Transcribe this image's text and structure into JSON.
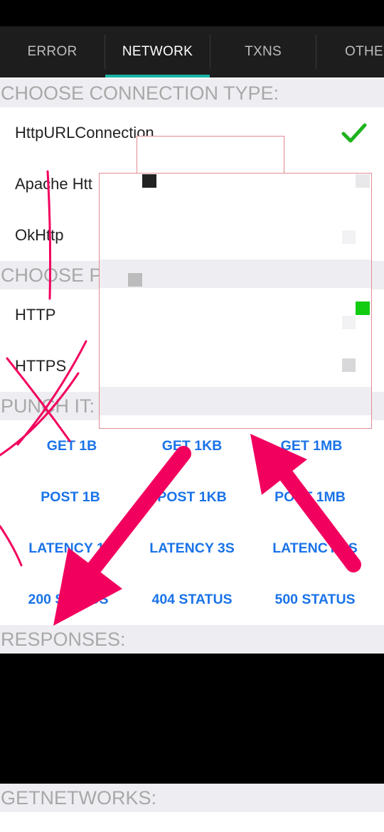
{
  "tabs": [
    {
      "label": "ERROR",
      "active": false
    },
    {
      "label": "NETWORK",
      "active": true
    },
    {
      "label": "TXNS",
      "active": false
    },
    {
      "label": "OTHE",
      "active": false
    }
  ],
  "sections": {
    "connection_type": "CHOOSE CONNECTION TYPE:",
    "protocol": "CHOOSE P",
    "punch_it": "PUNCH IT:",
    "responses": "RESPONSES:",
    "getnetworks": "GETNETWORKS:"
  },
  "connection_options": [
    {
      "label": "HttpURLConnection",
      "selected": true
    },
    {
      "label": "Apache Htt",
      "selected": false
    },
    {
      "label": "OkHttp",
      "selected": false
    }
  ],
  "protocol_options": [
    {
      "label": "HTTP"
    },
    {
      "label": "HTTPS"
    }
  ],
  "actions": [
    [
      "GET 1B",
      "GET 1KB",
      "GET 1MB"
    ],
    [
      "POST 1B",
      "POST 1KB",
      "POST 1MB"
    ],
    [
      "LATENCY 1S",
      "LATENCY 3S",
      "LATENCY 5S"
    ],
    [
      "200 STATUS",
      "404 STATUS",
      "500 STATUS"
    ]
  ],
  "colors": {
    "accent": "#19b5a5",
    "link": "#1a73e8",
    "check": "#1db31d",
    "annotation": "#f2005e"
  },
  "icons": {
    "selected": "checkmark-icon"
  }
}
